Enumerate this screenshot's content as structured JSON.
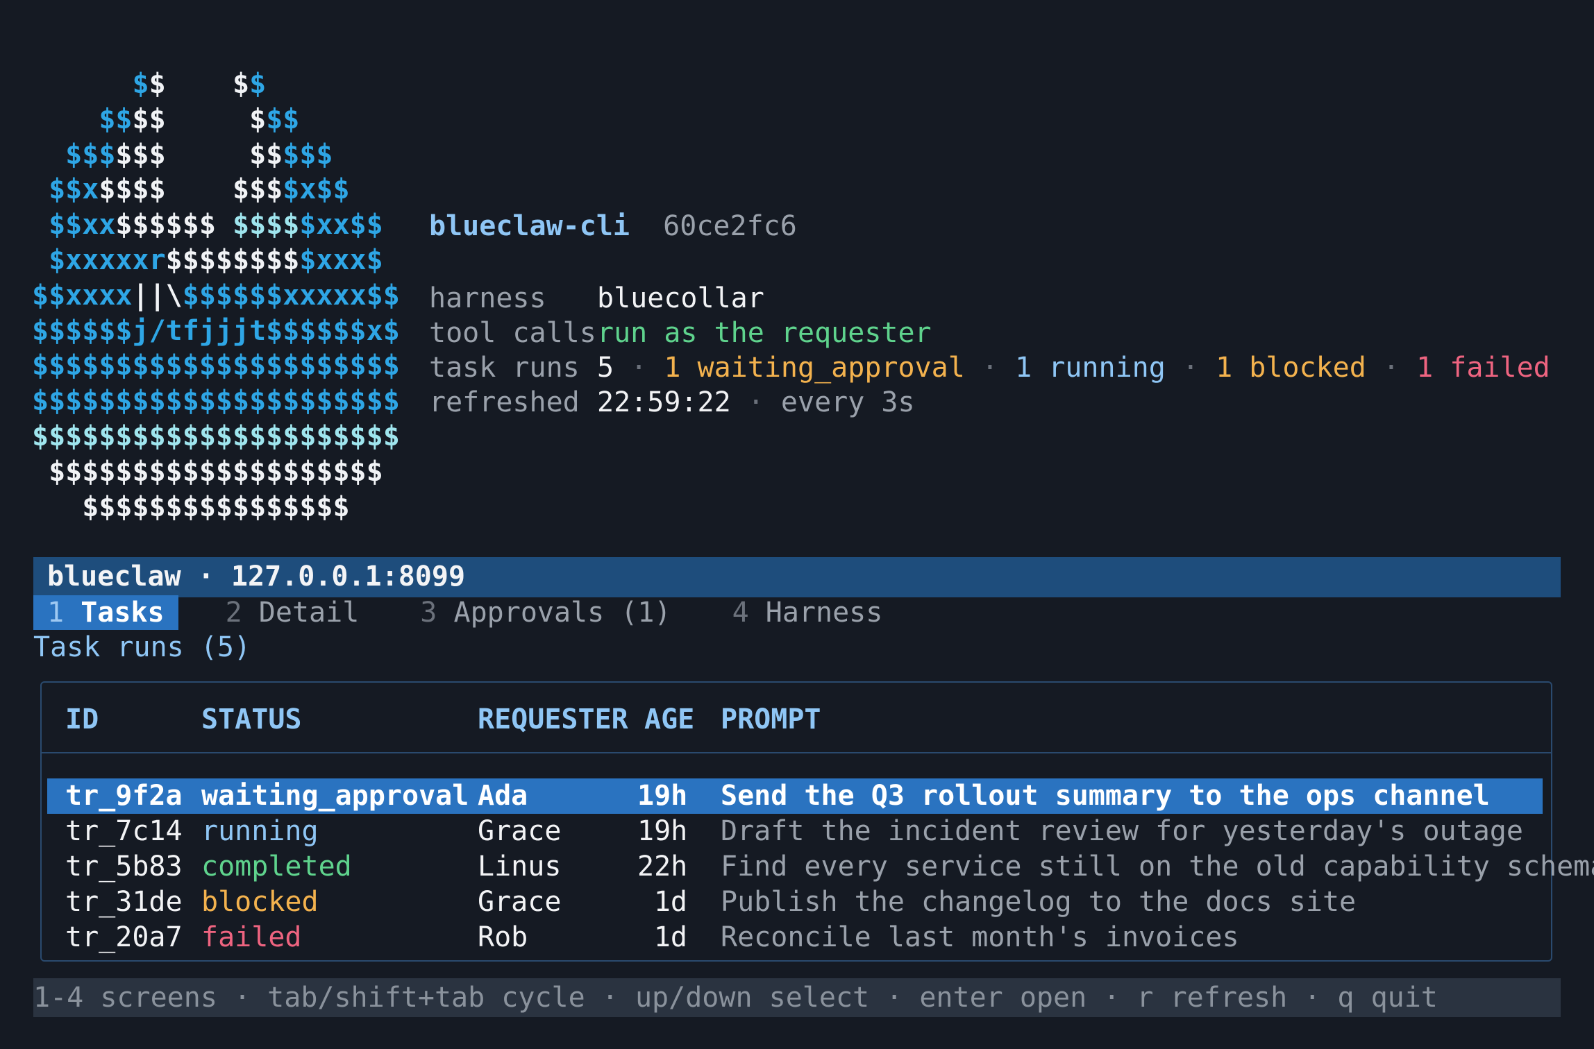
{
  "logo": {
    "lines": [
      [
        [
          "b",
          "      $"
        ],
        [
          "w",
          "$"
        ],
        [
          "b",
          "    "
        ],
        [
          "w",
          "$"
        ],
        [
          "b",
          "$"
        ]
      ],
      [
        [
          "b",
          "    $$"
        ],
        [
          "w",
          "$$"
        ],
        [
          "b",
          "     "
        ],
        [
          "w",
          "$"
        ],
        [
          "b",
          "$$"
        ]
      ],
      [
        [
          "b",
          "  $$$"
        ],
        [
          "w",
          "$$$"
        ],
        [
          "b",
          "     "
        ],
        [
          "w",
          "$$"
        ],
        [
          "b",
          "$$$"
        ]
      ],
      [
        [
          "b",
          " $$x"
        ],
        [
          "w",
          "$$$$"
        ],
        [
          "b",
          "    "
        ],
        [
          "w",
          "$$$"
        ],
        [
          "b",
          "$x$$"
        ]
      ],
      [
        [
          "b",
          " $$xx"
        ],
        [
          "w",
          "$$$$$$"
        ],
        [
          "b",
          " "
        ],
        [
          "c",
          "$$$$"
        ],
        [
          "b",
          "$xx$$"
        ]
      ],
      [
        [
          "b",
          " $xxxxxr"
        ],
        [
          "w",
          "$$$$$$$$"
        ],
        [
          "b",
          "$xxx$"
        ]
      ],
      [
        [
          "b",
          "$$xxxx"
        ],
        [
          "w",
          "||\\"
        ],
        [
          "b",
          "$$$$$$xxxxx$$"
        ]
      ],
      [
        [
          "b",
          "$$$$$$j/tfjjjt$$$$$$x$"
        ]
      ],
      [
        [
          "b",
          "$$$$$$$$$$$$$$$$$$$$$$"
        ]
      ],
      [
        [
          "b",
          "$$$$$$$$$$$$$$$$$$$$$$"
        ]
      ],
      [
        [
          "c",
          "$$$$$$$$$$$$$$$$$$$$$$"
        ]
      ],
      [
        [
          "w",
          " $$$$$$$$$$$$$$$$$$$$"
        ]
      ],
      [
        [
          "w",
          "   $$$$$$$$$$$$$$$$"
        ]
      ]
    ]
  },
  "header": {
    "app": "blueclaw-cli",
    "commit": "60ce2fc6",
    "harness_label": "harness",
    "harness_value": "bluecollar",
    "toolcalls_label": "tool calls",
    "toolcalls_value": "run as the requester",
    "taskruns_label": "task runs",
    "taskruns_total": "5",
    "taskruns_waiting": "1 waiting_approval",
    "taskruns_running": "1 running",
    "taskruns_blocked": "1 blocked",
    "taskruns_failed": "1 failed",
    "sep": " · ",
    "refreshed_label": "refreshed",
    "refreshed_time": "22:59:22",
    "refreshed_every": "every 3s"
  },
  "titlebar": "blueclaw · 127.0.0.1:8099",
  "tabs": [
    {
      "num": "1",
      "label": "Tasks",
      "active": true
    },
    {
      "num": "2",
      "label": "Detail",
      "active": false
    },
    {
      "num": "3",
      "label": "Approvals (1)",
      "active": false
    },
    {
      "num": "4",
      "label": "Harness",
      "active": false
    }
  ],
  "section_title": "Task runs (5)",
  "table": {
    "headers": {
      "id": "ID",
      "status": "STATUS",
      "requester": "REQUESTER",
      "age": "AGE",
      "prompt": "PROMPT"
    },
    "rows": [
      {
        "id": "tr_9f2a",
        "status": "waiting_approval",
        "requester": "Ada",
        "age": "19h",
        "prompt": "Send the Q3 rollout summary to the ops channel",
        "selected": true
      },
      {
        "id": "tr_7c14",
        "status": "running",
        "requester": "Grace",
        "age": "19h",
        "prompt": "Draft the incident review for yesterday's outage",
        "selected": false
      },
      {
        "id": "tr_5b83",
        "status": "completed",
        "requester": "Linus",
        "age": "22h",
        "prompt": "Find every service still on the old capability schema",
        "selected": false
      },
      {
        "id": "tr_31de",
        "status": "blocked",
        "requester": "Grace",
        "age": "1d",
        "prompt": "Publish the changelog to the docs site",
        "selected": false
      },
      {
        "id": "tr_20a7",
        "status": "failed",
        "requester": "Rob",
        "age": "1d",
        "prompt": "Reconcile last month's invoices",
        "selected": false
      }
    ]
  },
  "status_colors": {
    "waiting_approval": "#f3b24e",
    "running": "#8fc6f5",
    "completed": "#5fd38d",
    "blocked": "#f3b24e",
    "failed": "#ee6480"
  },
  "footer": "1-4 screens · tab/shift+tab cycle · up/down select · enter open · r refresh · q quit"
}
